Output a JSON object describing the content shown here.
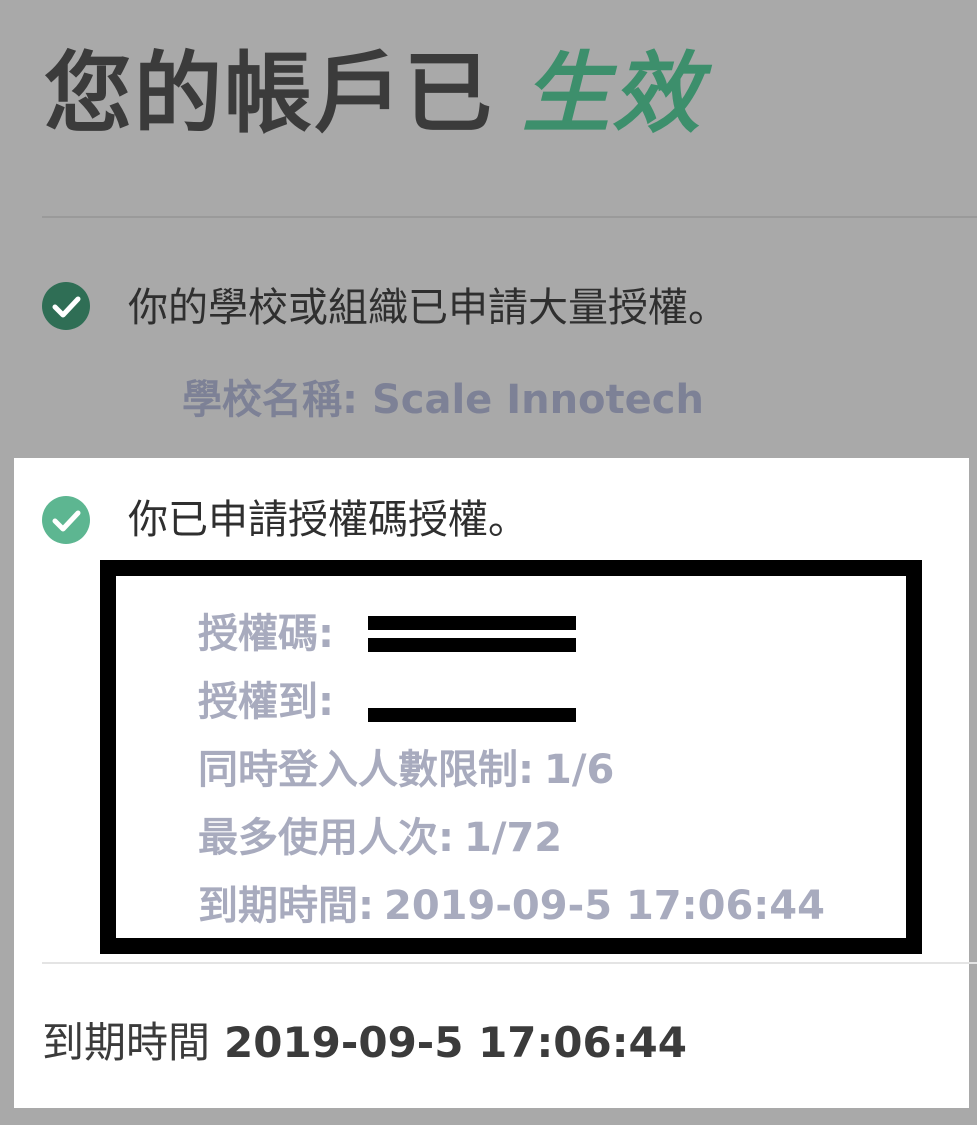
{
  "header": {
    "title_main": "您的帳戶已",
    "title_accent": "生效",
    "accent_color": "#3d8f6c"
  },
  "status_items": [
    {
      "icon": "check-circle-icon",
      "text": "你的學校或組織已申請大量授權。",
      "school_label": "學校名稱:",
      "school_name": "Scale Innotech"
    },
    {
      "icon": "check-circle-icon",
      "text": "你已申請授權碼授權。"
    }
  ],
  "license_details": {
    "code_label": "授權碼:",
    "code_value": "[redacted]",
    "licensee_label": "授權到:",
    "licensee_value": "[redacted]",
    "concurrent_label": "同時登入人數限制:",
    "concurrent_value": "1/6",
    "max_uses_label": "最多使用人次:",
    "max_uses_value": "1/72",
    "expiry_label": "到期時間:",
    "expiry_value": "2019-09-5 17:06:44"
  },
  "footer": {
    "expiry_label": "到期時間",
    "expiry_value": "2019-09-5 17:06:44"
  }
}
